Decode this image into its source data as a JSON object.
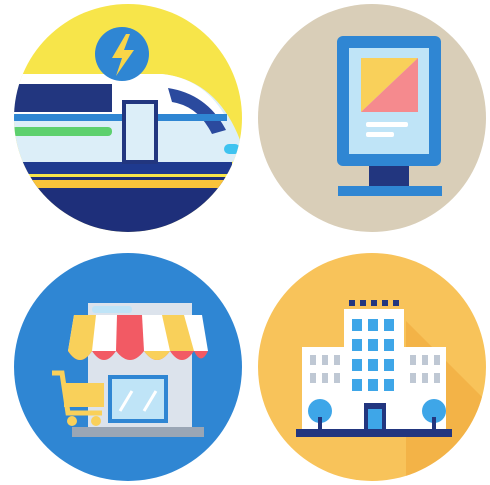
{
  "icons": [
    {
      "name": "electric-train-icon",
      "background": "#F7E54A"
    },
    {
      "name": "billboard-icon",
      "background": "#D9CEB8"
    },
    {
      "name": "shop-icon",
      "background": "#2F86D3"
    },
    {
      "name": "office-building-icon",
      "background": "#F8C35A"
    }
  ],
  "colors": {
    "navy": "#1F3A8F",
    "blue": "#2E8AE6",
    "light_blue": "#BFE4F7",
    "red": "#F25A64",
    "yellow": "#F7D24A",
    "grey": "#D9DEE6",
    "cream": "#F9DA7A"
  }
}
